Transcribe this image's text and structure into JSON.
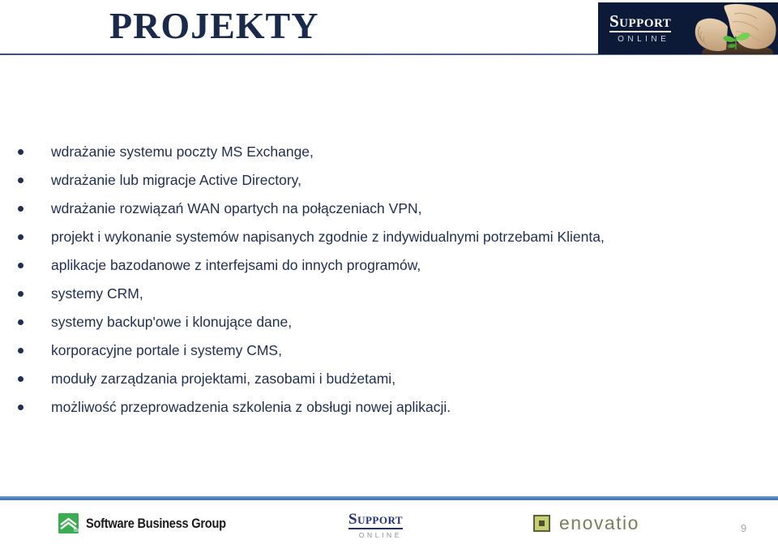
{
  "header": {
    "title": "PROJEKTY",
    "banner": {
      "wordmark_primary": "Support",
      "wordmark_secondary": "ONLINE",
      "image_alt": "hands-cradling-seedling-photo"
    }
  },
  "content": {
    "bullets": [
      "wdrażanie systemu poczty MS Exchange,",
      "wdrażanie lub migracje Active Directory,",
      "wdrażanie rozwiązań WAN opartych na połączeniach VPN,",
      "projekt i wykonanie systemów napisanych zgodnie z indywidualnymi potrzebami Klienta,",
      "aplikacje bazodanowe z interfejsami do innych programów,",
      "systemy CRM,",
      "systemy backup'owe i klonujące dane,",
      "korporacyjne portale i systemy CMS,",
      "moduły zarządzania projektami, zasobami i budżetami,",
      "możliwość przeprowadzenia szkolenia z obsługi nowej aplikacji."
    ]
  },
  "footer": {
    "logos": {
      "sbg": {
        "name": "Software Business Group",
        "mark_label": "SBG"
      },
      "support_online": {
        "primary": "Support",
        "secondary": "ONLINE"
      },
      "enovatio": {
        "name": "enovatio"
      }
    },
    "page_number": "9"
  },
  "colors": {
    "title_navy": "#1b2a4a",
    "body_navy": "#1f2f4d",
    "banner_navy": "#0c1a38",
    "footer_rule_blue": "#4f81bd",
    "sbg_green": "#3cab52",
    "enovatio_olive": "#7b7f5e",
    "support_online_blue": "#25307a"
  }
}
